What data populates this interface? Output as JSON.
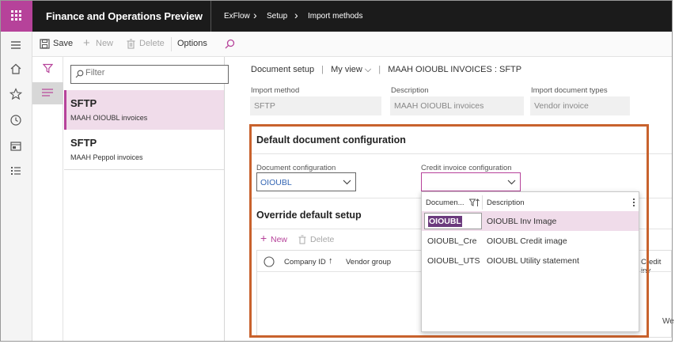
{
  "header": {
    "app_title": "Finance and Operations Preview",
    "breadcrumbs": [
      "ExFlow",
      "Setup",
      "Import methods"
    ]
  },
  "actions": {
    "save": "Save",
    "new": "New",
    "delete": "Delete",
    "options": "Options"
  },
  "list": {
    "filter_placeholder": "Filter",
    "items": [
      {
        "title": "SFTP",
        "subtitle": "MAAH OIOUBL invoices"
      },
      {
        "title": "SFTP",
        "subtitle": "MAAH Peppol invoices"
      }
    ]
  },
  "detail": {
    "view_label": "Document setup",
    "my_view": "My view",
    "record_title": "MAAH OIOUBL INVOICES : SFTP",
    "import_method_label": "Import method",
    "import_method_value": "SFTP",
    "description_label": "Description",
    "description_value": "MAAH OIOUBL invoices",
    "import_doc_types_label": "Import document types",
    "import_doc_types_value": "Vendor invoice"
  },
  "default_config": {
    "title": "Default document configuration",
    "doc_config_label": "Document configuration",
    "doc_config_value": "OIOUBL",
    "credit_config_label": "Credit invoice configuration",
    "credit_config_value": ""
  },
  "override": {
    "title": "Override default setup",
    "new": "New",
    "delete": "Delete",
    "columns": [
      "Company ID",
      "Vendor group",
      "Credit inv"
    ],
    "overflow_text": "We"
  },
  "lookup": {
    "col_document": "Documen...",
    "col_description": "Description",
    "rows": [
      {
        "code": "OIOUBL",
        "description": "OIOUBL Inv Image"
      },
      {
        "code": "OIOUBL_Cre",
        "description": "OIOUBL Credit image"
      },
      {
        "code": "OIOUBL_UTS",
        "description": "OIOUBL Utility statement"
      }
    ]
  },
  "colors": {
    "brand": "#b6429a",
    "topbar": "#1b1b1b",
    "highlight_frame": "#c8622d",
    "selected_row": "#f0dcea"
  }
}
